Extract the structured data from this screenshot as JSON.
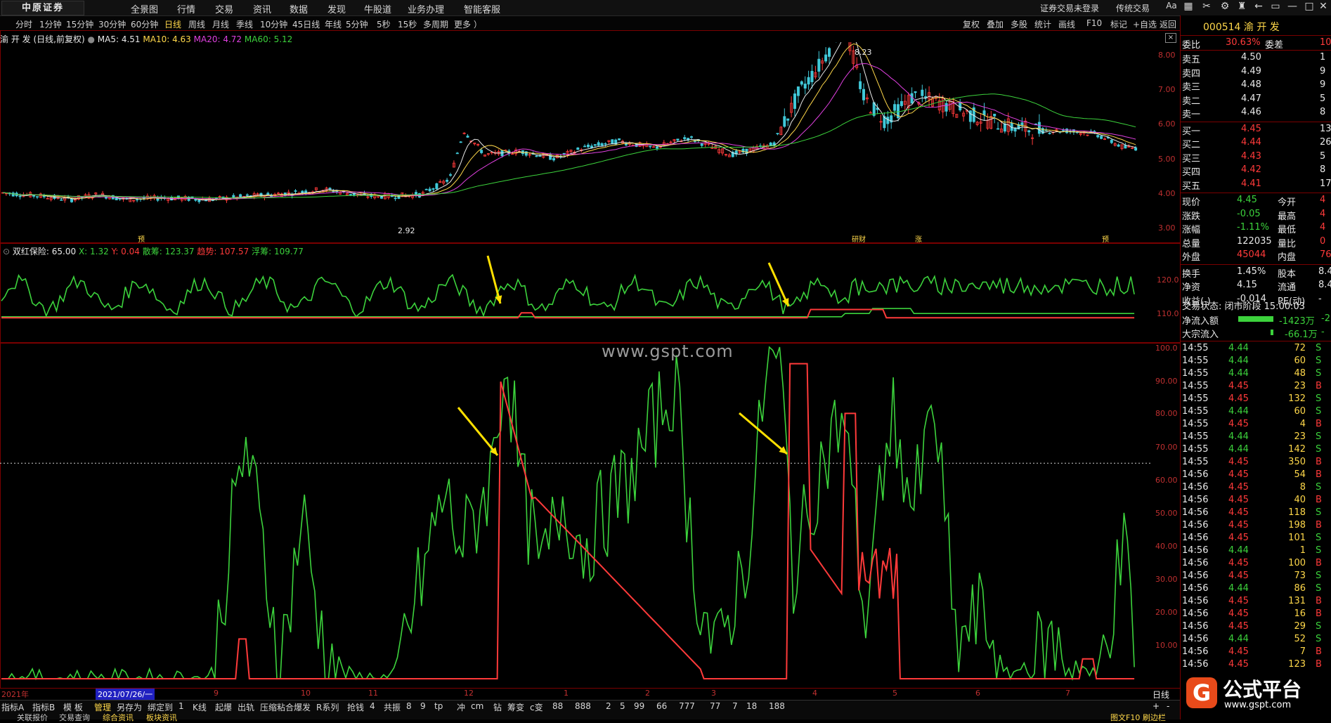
{
  "app": {
    "logo_text": "中原证券"
  },
  "top_menu": [
    "全景图",
    "行情",
    "交易",
    "资讯",
    "数据",
    "发现",
    "牛股道",
    "业务办理",
    "智能客服"
  ],
  "top_right": {
    "login": "证券交易未登录",
    "mode": "传统交易",
    "font_btn": "Aa"
  },
  "periods": [
    "分时",
    "1分钟",
    "15分钟",
    "30分钟",
    "60分钟",
    "日线",
    "周线",
    "月线",
    "季线",
    "10分钟",
    "45日线",
    "年线",
    "5分钟",
    "5秒",
    "15秒",
    "多周期",
    "更多 ）"
  ],
  "active_period": "日线",
  "chart_tools": [
    "复权",
    "叠加",
    "多股",
    "统计",
    "画线",
    "F10",
    "标记",
    "+自选",
    "返回"
  ],
  "main_legend": {
    "title": "渝 开 发 (日线,前复权)",
    "ma5": "MA5: 4.51",
    "ma10": "MA10: 4.63",
    "ma20": "MA20: 4.72",
    "ma60": "MA60: 5.12",
    "colors": {
      "ma5": "#e8e8e8",
      "ma10": "#ffd84a",
      "ma20": "#e040e0",
      "ma60": "#3cd23c"
    }
  },
  "price_axis": [
    "8.00",
    "7.00",
    "6.00",
    "5.00",
    "4.00",
    "3.00"
  ],
  "price_marks": {
    "high": "8.23",
    "low": "2.92"
  },
  "event_marks": [
    "S",
    "预",
    "研财",
    "涨",
    "预"
  ],
  "indicator_legend": {
    "name": "双红保险",
    "p": "65.00",
    "x": "X: 1.32",
    "y": "Y: 0.04",
    "s1": "散筹: 123.37",
    "s2": "趋势: 107.57",
    "s3": "浮筹: 109.77"
  },
  "ind_axis": [
    "120.0",
    "110.0"
  ],
  "watermark": "www.gspt.com",
  "osc_axis": [
    "100.0",
    "90.00",
    "80.00",
    "70.00",
    "60.00",
    "50.00",
    "40.00",
    "30.00",
    "20.00",
    "10.00"
  ],
  "date_axis": [
    "2021年",
    "2021/07/26/一",
    "9",
    "10",
    "11",
    "12",
    "1",
    "2",
    "3",
    "4",
    "5",
    "6",
    "7"
  ],
  "bottom_tools": [
    "指标A",
    "指标B",
    "模 板",
    "管理",
    "另存为",
    "绑定到",
    "1",
    "K线",
    "起爆",
    "出轨",
    "压缩粘合爆发",
    "R系列",
    "抢钱",
    "4",
    "共振",
    "8",
    "9",
    "tp",
    "冲",
    "cm",
    "钻",
    "筹变",
    "c变",
    "88",
    "888",
    "2",
    "5",
    "99",
    "66",
    "777",
    "77",
    "7",
    "18",
    "188"
  ],
  "bottom_right": {
    "period": "日线",
    "plus": "+",
    "minus": "-"
  },
  "status_bar": [
    "关联报价",
    "交易查询",
    "综合资讯",
    "板块资讯"
  ],
  "status_right": "图文F10  刷边栏",
  "quote": {
    "code_name": "000514 渝 开 发",
    "weibi": {
      "label": "委比",
      "value": "30.63%",
      "label2": "委差",
      "value2": "10"
    },
    "sells": [
      {
        "label": "卖五",
        "price": "4.50",
        "vol": "1"
      },
      {
        "label": "卖四",
        "price": "4.49",
        "vol": "9"
      },
      {
        "label": "卖三",
        "price": "4.48",
        "vol": "9"
      },
      {
        "label": "卖二",
        "price": "4.47",
        "vol": "5"
      },
      {
        "label": "卖一",
        "price": "4.46",
        "vol": "8"
      }
    ],
    "buys": [
      {
        "label": "买一",
        "price": "4.45",
        "vol": "13"
      },
      {
        "label": "买二",
        "price": "4.44",
        "vol": "26"
      },
      {
        "label": "买三",
        "price": "4.43",
        "vol": "5"
      },
      {
        "label": "买四",
        "price": "4.42",
        "vol": "8"
      },
      {
        "label": "买五",
        "price": "4.41",
        "vol": "17"
      }
    ],
    "stats": [
      {
        "l1": "现价",
        "v1": "4.45",
        "c1": "grn",
        "l2": "今开",
        "v2": "4"
      },
      {
        "l1": "涨跌",
        "v1": "-0.05",
        "c1": "grn",
        "l2": "最高",
        "v2": "4"
      },
      {
        "l1": "涨幅",
        "v1": "-1.11%",
        "c1": "grn",
        "l2": "最低",
        "v2": "4"
      },
      {
        "l1": "总量",
        "v1": "122035",
        "c1": "wht",
        "l2": "量比",
        "v2": "0"
      },
      {
        "l1": "外盘",
        "v1": "45044",
        "c1": "red",
        "l2": "内盘",
        "v2": "769"
      }
    ],
    "stats2": [
      {
        "l1": "换手",
        "v1": "1.45%",
        "l2": "股本",
        "v2": "8.4"
      },
      {
        "l1": "净资",
        "v1": "4.15",
        "l2": "流通",
        "v2": "8.4"
      },
      {
        "l1": "收益(-)",
        "v1": "-0.014",
        "l2": "PE(动)",
        "v2": "-"
      }
    ],
    "trade_state": "交易状态: 闭市阶段 15:00:03",
    "net_inflow": {
      "label": "净流入额",
      "value": "-1423万",
      "tail": "-2"
    },
    "block_inflow": {
      "label": "大宗流入",
      "value": "-66.1万",
      "tail": "-"
    },
    "ticks": [
      [
        "14:55",
        "4.44",
        "72",
        "S"
      ],
      [
        "14:55",
        "4.44",
        "60",
        "S"
      ],
      [
        "14:55",
        "4.44",
        "48",
        "S"
      ],
      [
        "14:55",
        "4.45",
        "23",
        "B"
      ],
      [
        "14:55",
        "4.45",
        "132",
        "S"
      ],
      [
        "14:55",
        "4.44",
        "60",
        "S"
      ],
      [
        "14:55",
        "4.45",
        "4",
        "B"
      ],
      [
        "14:55",
        "4.44",
        "23",
        "S"
      ],
      [
        "14:55",
        "4.44",
        "142",
        "S"
      ],
      [
        "14:55",
        "4.45",
        "350",
        "B"
      ],
      [
        "14:56",
        "4.45",
        "54",
        "B"
      ],
      [
        "14:56",
        "4.45",
        "8",
        "S"
      ],
      [
        "14:56",
        "4.45",
        "40",
        "B"
      ],
      [
        "14:56",
        "4.45",
        "118",
        "S"
      ],
      [
        "14:56",
        "4.45",
        "198",
        "B"
      ],
      [
        "14:56",
        "4.45",
        "101",
        "S"
      ],
      [
        "14:56",
        "4.44",
        "1",
        "S"
      ],
      [
        "14:56",
        "4.45",
        "100",
        "B"
      ],
      [
        "14:56",
        "4.45",
        "73",
        "S"
      ],
      [
        "14:56",
        "4.44",
        "86",
        "S"
      ],
      [
        "14:56",
        "4.45",
        "131",
        "B"
      ],
      [
        "14:56",
        "4.45",
        "16",
        "B"
      ],
      [
        "14:56",
        "4.45",
        "29",
        "S"
      ],
      [
        "14:56",
        "4.44",
        "52",
        "S"
      ],
      [
        "14:56",
        "4.45",
        "7",
        "B"
      ],
      [
        "14:56",
        "4.45",
        "123",
        "B"
      ]
    ]
  },
  "gspt": {
    "title": "公式平台",
    "url": "www.gspt.com"
  }
}
